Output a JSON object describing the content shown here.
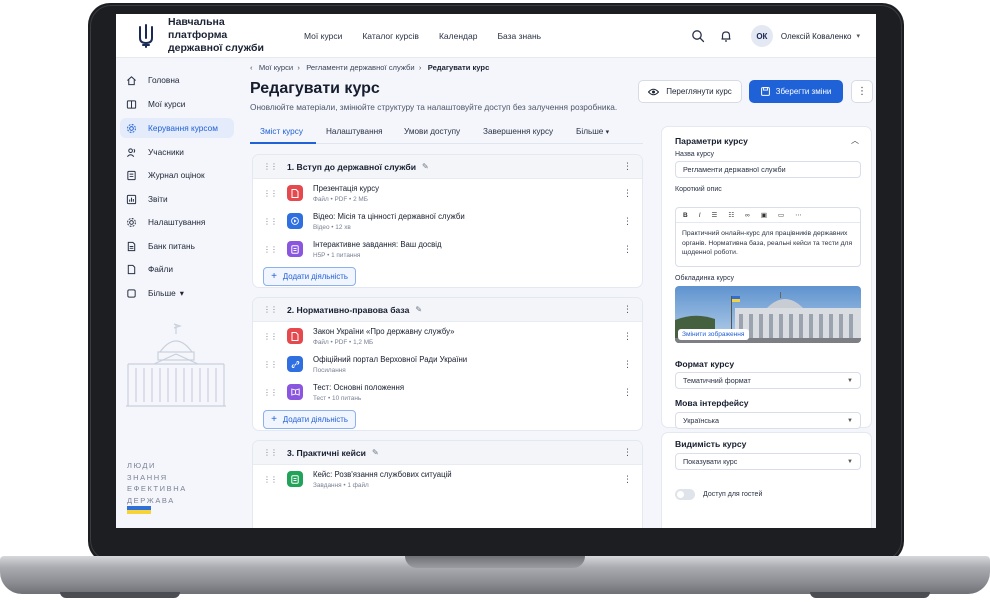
{
  "header": {
    "brand_line1": "Навчальна платформа",
    "brand_line2": "державної служби",
    "nav": [
      "Мої курси",
      "Каталог курсів",
      "Календар",
      "База знань"
    ],
    "user_initials": "ОК",
    "user_name": "Олексій Коваленко"
  },
  "sidebar": {
    "items": [
      {
        "label": "Головна",
        "icon": "home-icon"
      },
      {
        "label": "Мої курси",
        "icon": "book-icon"
      },
      {
        "label": "Керування курсом",
        "icon": "gear-icon",
        "active": true
      },
      {
        "label": "Учасники",
        "icon": "users-icon"
      },
      {
        "label": "Журнал оцінок",
        "icon": "gradebook-icon"
      },
      {
        "label": "Звіти",
        "icon": "chart-icon"
      },
      {
        "label": "Налаштування",
        "icon": "settings-icon"
      },
      {
        "label": "Банк питань",
        "icon": "document-icon"
      },
      {
        "label": "Файли",
        "icon": "file-icon"
      },
      {
        "label": "Більше",
        "icon": "square-icon"
      }
    ],
    "slogan": [
      "ЛЮДИ",
      "ЗНАННЯ",
      "ЕФЕКТИВНА",
      "ДЕРЖАВА"
    ],
    "flag_colors": [
      "#2f6fd6",
      "#f7d33b"
    ]
  },
  "breadcrumb": {
    "items": [
      "Мої курси",
      "Регламенти державної служби"
    ],
    "current": "Редагувати курс"
  },
  "page": {
    "title": "Редагувати курс",
    "subtitle": "Оновлюйте матеріали, змінюйте структуру та налаштовуйте доступ без залучення розробника.",
    "preview_label": "Переглянути курс",
    "save_label": "Зберегти зміни"
  },
  "tabs": [
    "Зміст курсу",
    "Налаштування",
    "Умови доступу",
    "Завершення курсу",
    "Більше"
  ],
  "sections": [
    {
      "title": "1. Вступ до державної служби",
      "items": [
        {
          "title": "Презентація курсу",
          "meta": "Файл • PDF • 2 МБ",
          "icon": "pdf-icon",
          "color": "#e5484d"
        },
        {
          "title": "Відео: Місія та цінності державної служби",
          "meta": "Відео • 12 хв",
          "icon": "video-icon",
          "color": "#2f6fe0"
        },
        {
          "title": "Інтерактивне завдання: Ваш досвід",
          "meta": "H5P • 1 питання",
          "icon": "h5p-icon",
          "color": "#8a56e0"
        }
      ],
      "add_label": "Додати діяльність"
    },
    {
      "title": "2. Нормативно-правова база",
      "items": [
        {
          "title": "Закон України «Про державну службу»",
          "meta": "Файл • PDF • 1,2 МБ",
          "icon": "pdf-icon",
          "color": "#e5484d"
        },
        {
          "title": "Офіційний портал Верховної Ради України",
          "meta": "Посилання",
          "icon": "link-icon",
          "color": "#2f6fe0"
        },
        {
          "title": "Тест: Основні положення",
          "meta": "Тест • 10 питань",
          "icon": "quiz-icon",
          "color": "#8a56e0"
        }
      ],
      "add_label": "Додати діяльність"
    },
    {
      "title": "3. Практичні кейси",
      "items": [
        {
          "title": "Кейс: Розв'язання службових ситуацій",
          "meta": "Завдання • 1 файл",
          "icon": "case-icon",
          "color": "#22a35a"
        }
      ]
    }
  ],
  "right_panel": {
    "title": "Параметри курсу",
    "name_label": "Назва курсу",
    "name_value": "Регламенти державної служби",
    "desc_label": "Короткий опис",
    "desc_value": "Практичний онлайн-курс для працівників державних органів. Нормативна база, реальні кейси та тести для щоденної роботи.",
    "cover_label": "Обкладинка курсу",
    "change_image_label": "Змінити зображення",
    "format_label": "Формат курсу",
    "format_value": "Тематичний формат",
    "language_label": "Мова інтерфейсу",
    "language_value": "Українська"
  },
  "visibility_panel": {
    "title": "Видимість курсу",
    "visibility_value": "Показувати курс",
    "guest_label": "Доступ для гостей"
  },
  "colors": {
    "primary": "#1f62d8",
    "active_bg": "#e4ecfb"
  }
}
